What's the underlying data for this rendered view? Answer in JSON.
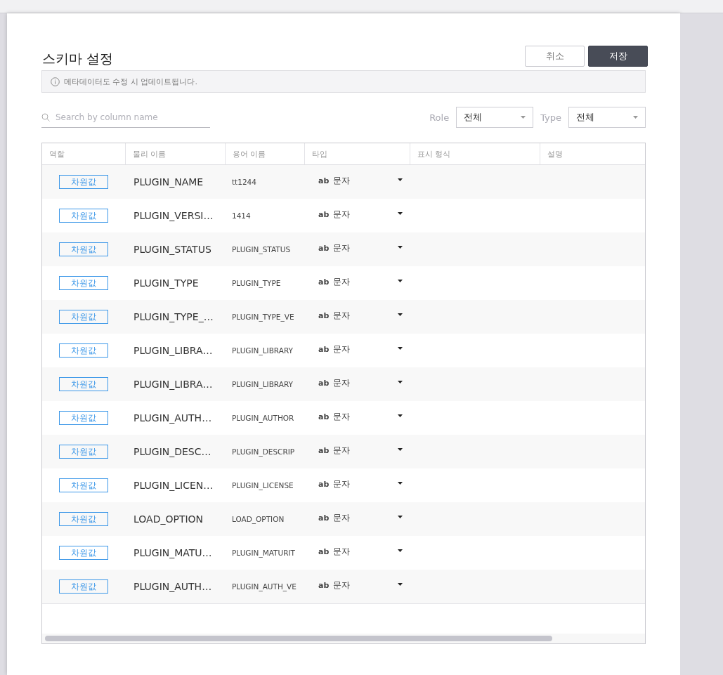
{
  "dialog": {
    "title": "스키마 설정",
    "buttons": [
      {
        "label": "취소",
        "kind": "secondary"
      },
      {
        "label": "저장",
        "kind": "primary"
      }
    ],
    "notice": "메타데이터도 수정 시 업데이트됩니다.",
    "search": {
      "placeholder": "Search by column name"
    },
    "filters": [
      {
        "label": "Role",
        "value": "전체"
      },
      {
        "label": "Type",
        "value": "전체"
      }
    ],
    "table": {
      "columns": [
        "역할",
        "물리 이름",
        "용어 이름",
        "타입",
        "표시 형식",
        "설명"
      ],
      "rows": [
        {
          "role": "차원값",
          "physical_name": "PLUGIN_NAME",
          "logical_name": "tt1244",
          "type_icon": "ab",
          "type": "문자"
        },
        {
          "role": "차원값",
          "physical_name": "PLUGIN_VERSI…",
          "logical_name": "1414",
          "type_icon": "ab",
          "type": "문자"
        },
        {
          "role": "차원값",
          "physical_name": "PLUGIN_STATUS",
          "logical_name": "PLUGIN_STATUS",
          "type_icon": "ab",
          "type": "문자"
        },
        {
          "role": "차원값",
          "physical_name": "PLUGIN_TYPE",
          "logical_name": "PLUGIN_TYPE",
          "type_icon": "ab",
          "type": "문자"
        },
        {
          "role": "차원값",
          "physical_name": "PLUGIN_TYPE_…",
          "logical_name": "PLUGIN_TYPE_VE",
          "type_icon": "ab",
          "type": "문자"
        },
        {
          "role": "차원값",
          "physical_name": "PLUGIN_LIBRA…",
          "logical_name": "PLUGIN_LIBRARY",
          "type_icon": "ab",
          "type": "문자"
        },
        {
          "role": "차원값",
          "physical_name": "PLUGIN_LIBRA…",
          "logical_name": "PLUGIN_LIBRARY",
          "type_icon": "ab",
          "type": "문자"
        },
        {
          "role": "차원값",
          "physical_name": "PLUGIN_AUTH…",
          "logical_name": "PLUGIN_AUTHOR",
          "type_icon": "ab",
          "type": "문자"
        },
        {
          "role": "차원값",
          "physical_name": "PLUGIN_DESC…",
          "logical_name": "PLUGIN_DESCRIP",
          "type_icon": "ab",
          "type": "문자"
        },
        {
          "role": "차원값",
          "physical_name": "PLUGIN_LICEN…",
          "logical_name": "PLUGIN_LICENSE",
          "type_icon": "ab",
          "type": "문자"
        },
        {
          "role": "차원값",
          "physical_name": "LOAD_OPTION",
          "logical_name": "LOAD_OPTION",
          "type_icon": "ab",
          "type": "문자"
        },
        {
          "role": "차원값",
          "physical_name": "PLUGIN_MATU…",
          "logical_name": "PLUGIN_MATURIT",
          "type_icon": "ab",
          "type": "문자"
        },
        {
          "role": "차원값",
          "physical_name": "PLUGIN_AUTH…",
          "logical_name": "PLUGIN_AUTH_VE",
          "type_icon": "ab",
          "type": "문자"
        }
      ]
    }
  }
}
